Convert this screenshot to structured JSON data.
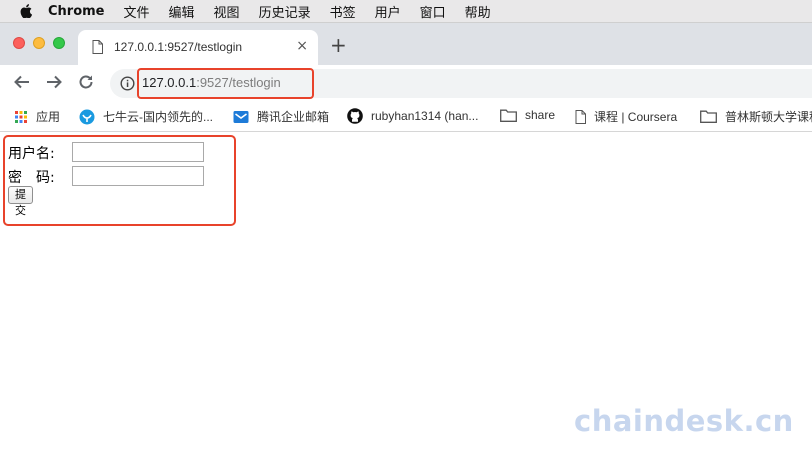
{
  "menubar": {
    "app_name": "Chrome",
    "items": [
      "文件",
      "编辑",
      "视图",
      "历史记录",
      "书签",
      "用户",
      "窗口",
      "帮助"
    ]
  },
  "tab": {
    "title": "127.0.0.1:9527/testlogin",
    "close_glyph": "×"
  },
  "new_tab_glyph": "+",
  "address_bar": {
    "host": "127.0.0.1",
    "path": ":9527/testlogin"
  },
  "bookmarks": [
    {
      "label": "应用",
      "icon": "apps-grid-icon"
    },
    {
      "label": "七牛云-国内领先的...",
      "icon": "qiniu-icon"
    },
    {
      "label": "腾讯企业邮箱",
      "icon": "tencent-mail-icon"
    },
    {
      "label": "rubyhan1314 (han...",
      "icon": "github-icon"
    },
    {
      "label": "share",
      "icon": "folder-icon"
    },
    {
      "label": "课程 | Coursera",
      "icon": "page-icon"
    },
    {
      "label": "普林斯顿大学课程",
      "icon": "folder-icon"
    }
  ],
  "form": {
    "username_label": "用户名:",
    "password_label": "密　码:",
    "username_value": "",
    "password_value": "",
    "submit_label": "提交"
  },
  "watermark": "chaindesk.cn",
  "colors": {
    "highlight": "#e8432b",
    "tabstrip": "#dee1e6",
    "watermark": "#c7d6ee"
  }
}
